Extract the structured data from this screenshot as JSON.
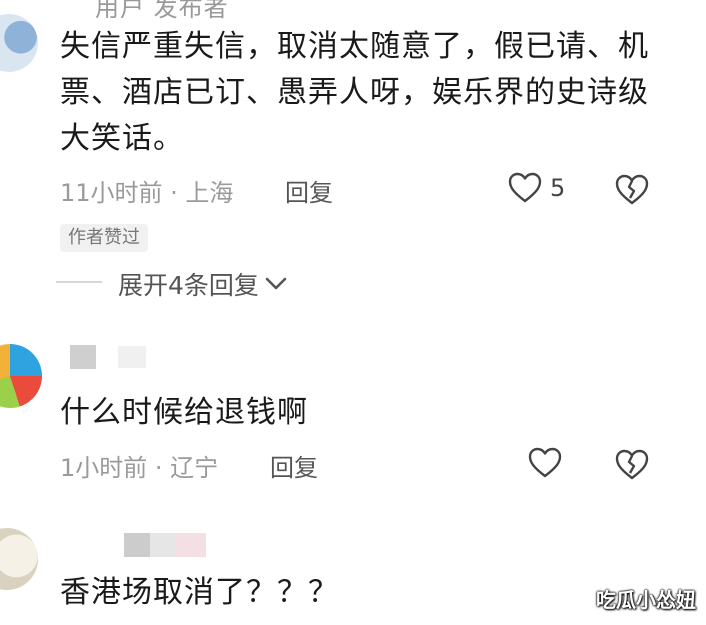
{
  "header_fragment": "用户 发布者",
  "comments": [
    {
      "text": "失信严重失信，取消太随意了，假已请、机票、酒店已订、愚弄人呀，娱乐界的史诗级大笑话。",
      "meta": "11小时前 · 上海",
      "reply_label": "回复",
      "like_count": "5",
      "badge": "作者赞过",
      "expand_label": "展开4条回复"
    },
    {
      "text": "什么时候给退钱啊",
      "meta": "1小时前 · 辽宁",
      "reply_label": "回复"
    },
    {
      "text": "香港场取消了？？？"
    }
  ],
  "watermark": "吃瓜小怂妞",
  "icons": {
    "like": "heart-outline-icon",
    "dislike": "broken-heart-icon",
    "expand": "chevron-down-icon"
  }
}
